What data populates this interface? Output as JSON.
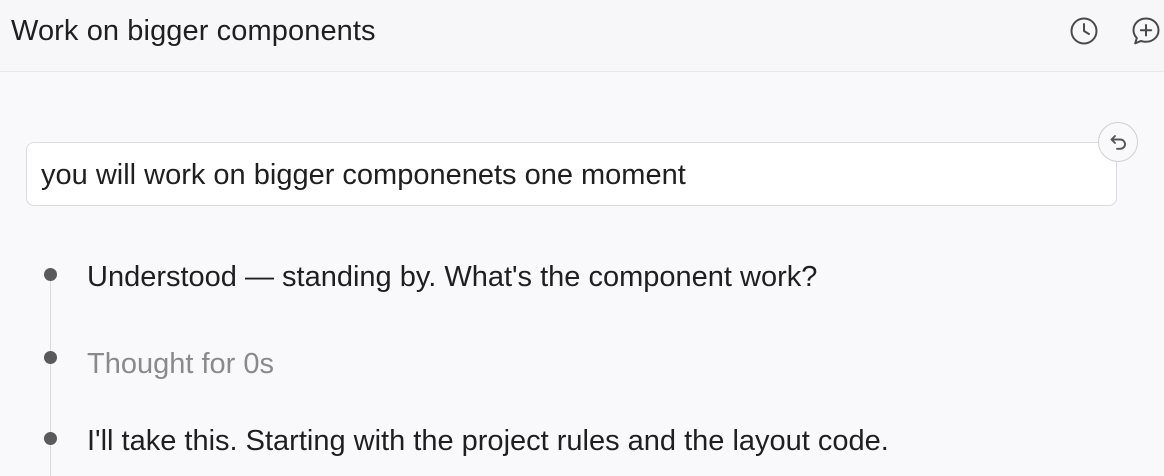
{
  "header": {
    "title": "Work on bigger components",
    "icons": [
      "history-icon",
      "new-chat-icon"
    ]
  },
  "conversation": {
    "user_message": "you will work on bigger componenets one moment",
    "revert_icon": "revert-icon",
    "entries": [
      {
        "text": "Understood — standing by. What's the component work?",
        "kind": "response"
      },
      {
        "text": "Thought for 0s",
        "kind": "thought"
      },
      {
        "text": "I'll take this. Starting with the project rules and the layout code.",
        "kind": "response"
      }
    ]
  },
  "colors": {
    "background": "#f9f9fb",
    "text": "#1f1f1f",
    "muted_text": "#8a8a8e",
    "bullet": "#5a5a5e",
    "border": "#dcdce0"
  }
}
